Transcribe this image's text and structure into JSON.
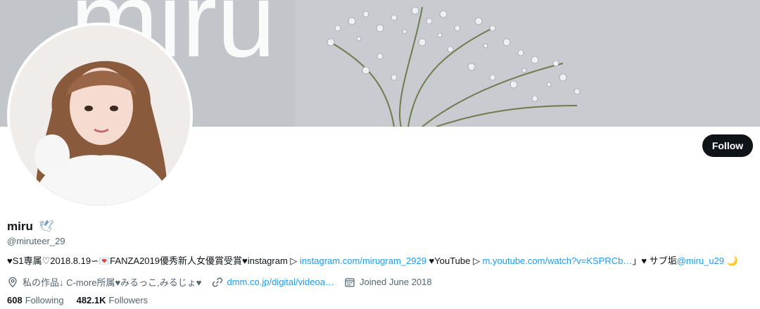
{
  "banner": {
    "text": "miru"
  },
  "profile": {
    "display_name": "miru",
    "name_emoji": "🕊",
    "handle": "@miruteer_29"
  },
  "actions": {
    "follow_label": "Follow"
  },
  "bio": {
    "part1": "♥S1専属♡2018.8.19∽💌FANZA2019優秀新人女優賞受賞♥instagram ▷ ",
    "link1": "instagram.com/mirugram_2929",
    "part2": " ♥YouTube ▷ ",
    "link2": "m.youtube.com/watch?v=KSPRCb…",
    "part3": "」♥ サブ垢",
    "mention": "@miru_u29",
    "part4": " 🌙"
  },
  "meta": {
    "location": "私の作品↓ C-more所属♥みるっこ,みるじょ♥",
    "url": "dmm.co.jp/digital/videoa…",
    "joined": "Joined June 2018"
  },
  "stats": {
    "following_count": "608",
    "following_label": "Following",
    "followers_count": "482.1K",
    "followers_label": "Followers"
  },
  "colors": {
    "link": "#1d9bf0",
    "text": "#0f1419",
    "muted": "#536471",
    "button_bg": "#0f1419"
  }
}
